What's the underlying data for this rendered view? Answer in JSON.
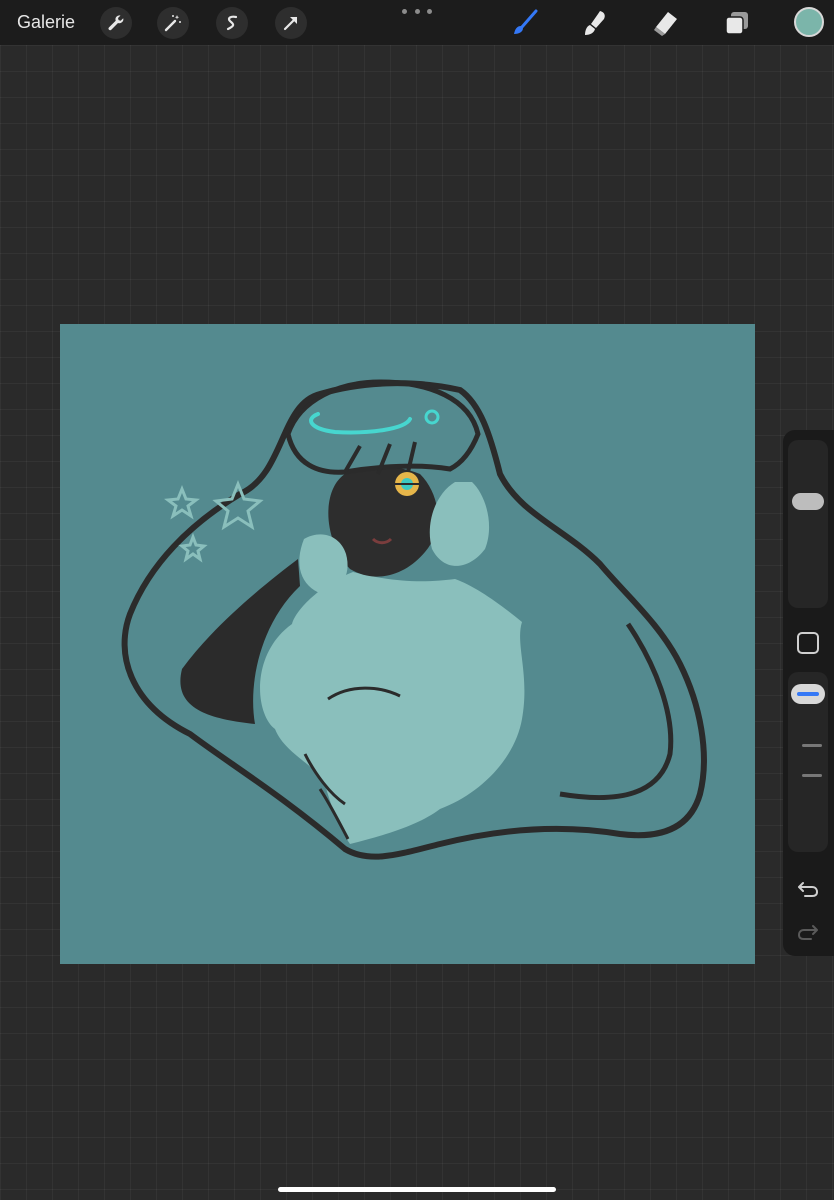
{
  "toolbar": {
    "gallery_label": "Galerie",
    "left_tools": [
      {
        "icon": "wrench-icon",
        "name": "actions"
      },
      {
        "icon": "magic-wand-icon",
        "name": "adjustments"
      },
      {
        "icon": "selection-s-icon",
        "name": "selection"
      },
      {
        "icon": "arrow-cursor-icon",
        "name": "transform"
      }
    ],
    "more_icon": "more-dots-icon",
    "right_tools": [
      {
        "icon": "brush-icon",
        "name": "paint",
        "active": true
      },
      {
        "icon": "smudge-icon",
        "name": "smudge"
      },
      {
        "icon": "eraser-icon",
        "name": "eraser"
      },
      {
        "icon": "layers-icon",
        "name": "layers"
      }
    ],
    "current_color": "#7bb5aa"
  },
  "colors": {
    "canvas_background": "#548a8f",
    "active_tool": "#3478f6",
    "app_background": "#2a2a2a"
  },
  "sidebar": {
    "brush_size": 0.65,
    "opacity": 0.95,
    "undo_icon": "undo-icon",
    "redo_icon": "redo-icon",
    "modify_icon": "modify-square-icon"
  }
}
